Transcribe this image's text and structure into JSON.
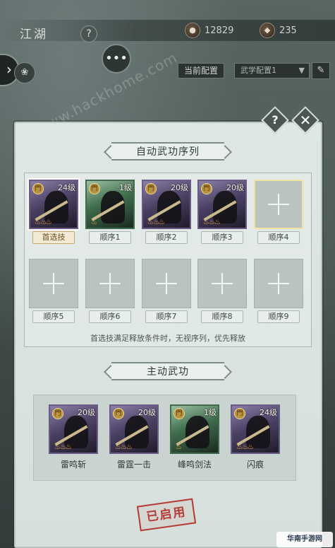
{
  "background": {
    "region_title": "江湖",
    "currency_a": {
      "value": "12829"
    },
    "currency_b": {
      "value": "235"
    },
    "equip_label": "当前配置",
    "equip_select": "武学配置1",
    "watermark": "www.hackhome.com"
  },
  "panel": {
    "auto_title": "自动武功序列",
    "active_title": "主动武功",
    "hint": "首选技满足释放条件时，无视序列，优先释放",
    "auto_slots": [
      {
        "level": "24级",
        "tag": "首选技",
        "primary": true,
        "filled": true,
        "color": "purple",
        "stars": "666"
      },
      {
        "level": "1级",
        "tag": "顺序1",
        "filled": true,
        "color": "green",
        "stars": "6"
      },
      {
        "level": "20级",
        "tag": "顺序2",
        "filled": true,
        "color": "purple",
        "stars": "666"
      },
      {
        "level": "20级",
        "tag": "顺序3",
        "filled": true,
        "color": "purple",
        "stars": "666"
      },
      {
        "tag": "顺序4",
        "filled": false
      },
      {
        "tag": "顺序5",
        "filled": false
      },
      {
        "tag": "顺序6",
        "filled": false
      },
      {
        "tag": "顺序7",
        "filled": false
      },
      {
        "tag": "顺序8",
        "filled": false
      },
      {
        "tag": "顺序9",
        "filled": false
      }
    ],
    "active_skills": [
      {
        "level": "20级",
        "name": "雷鸣斩",
        "color": "purple",
        "stars": "666"
      },
      {
        "level": "20级",
        "name": "雷霆一击",
        "color": "purple",
        "stars": "666"
      },
      {
        "level": "1级",
        "name": "峰鸣剑法",
        "color": "green",
        "stars": "6"
      },
      {
        "level": "24级",
        "name": "闪痕",
        "color": "purple",
        "stars": "666"
      }
    ],
    "stamp": "已启用"
  },
  "footer": {
    "corner_logo": "华南手游网"
  }
}
